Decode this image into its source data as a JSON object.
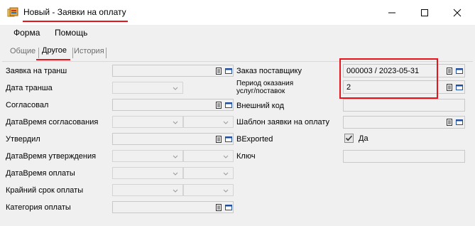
{
  "window": {
    "title": "Новый - Заявки на оплату",
    "minimize_icon": "minimize-icon",
    "maximize_icon": "maximize-icon",
    "close_icon": "close-icon"
  },
  "menu": {
    "items": [
      {
        "label": "Форма"
      },
      {
        "label": "Помощь"
      }
    ]
  },
  "tabs": [
    {
      "label": "Общие",
      "active": false
    },
    {
      "label": "Другое",
      "active": true
    },
    {
      "label": "История",
      "active": false
    }
  ],
  "left_fields": [
    {
      "label": "Заявка на транш",
      "type": "lookup",
      "value": ""
    },
    {
      "label": "Дата транша",
      "type": "date",
      "value": ""
    },
    {
      "label": "Согласовал",
      "type": "lookup",
      "value": ""
    },
    {
      "label": "ДатаВремя согласования",
      "type": "datetime",
      "value": ""
    },
    {
      "label": "Утвердил",
      "type": "lookup",
      "value": ""
    },
    {
      "label": "ДатаВремя утверждения",
      "type": "datetime",
      "value": ""
    },
    {
      "label": "ДатаВремя оплаты",
      "type": "datetime",
      "value": ""
    },
    {
      "label": "Крайний срок оплаты",
      "type": "datetime",
      "value": ""
    },
    {
      "label": "Категория оплаты",
      "type": "lookup",
      "value": ""
    }
  ],
  "right_fields": {
    "supplier_order": {
      "label": "Заказ поставщику",
      "value": "000003 / 2023-05-31"
    },
    "service_period": {
      "label_line1": "Период оказания",
      "label_line2": "услуг/поставок",
      "value": "2"
    },
    "external_code": {
      "label": "Внешний код",
      "value": ""
    },
    "template": {
      "label": "Шаблон заявки на оплату",
      "value": ""
    },
    "exported": {
      "label": "BExported",
      "checked": true,
      "check_label": "Да"
    },
    "key": {
      "label": "Ключ",
      "value": ""
    }
  },
  "colors": {
    "annotation_red": "#e8141b",
    "window_bg": "#f0f0f0",
    "field_border": "#c8c8c8"
  }
}
